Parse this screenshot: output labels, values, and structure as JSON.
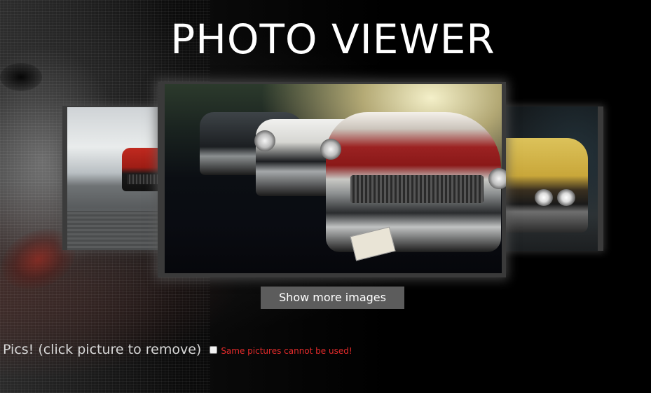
{
  "header": {
    "title": "PHOTO VIEWER"
  },
  "gallery": {
    "left_photo_alt": "red sports car on road",
    "center_photo_alt": "classic cars lined up at sunset",
    "right_photo_alt": "yellow muscle car"
  },
  "actions": {
    "show_more_label": "Show more images"
  },
  "footer": {
    "pics_label": "Pics! (click picture to remove)",
    "same_pictures_warning": "Same pictures cannot be used!",
    "same_pictures_checked": false
  },
  "colors": {
    "background": "#000000",
    "button_bg": "#5c5c5c",
    "warning": "#e52b2b",
    "title": "#ffffff"
  }
}
